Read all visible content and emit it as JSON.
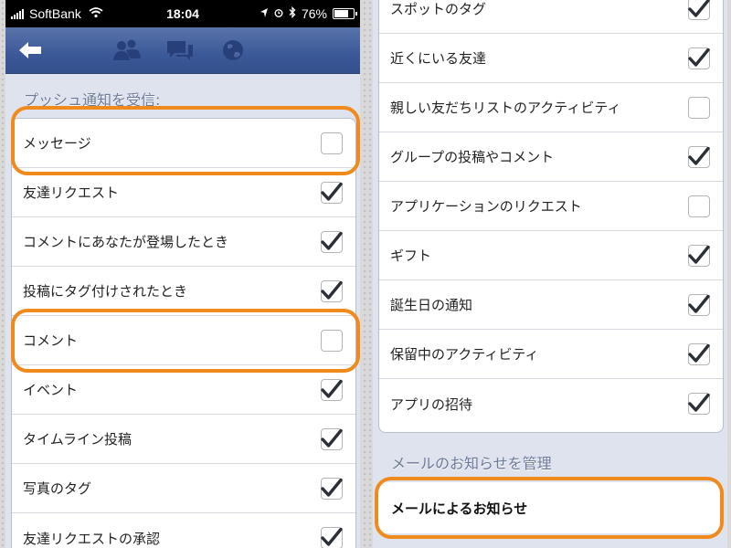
{
  "status_bar": {
    "carrier": "SoftBank",
    "time": "18:04",
    "battery": "76%",
    "battery_level": 0.76
  },
  "left_panel": {
    "section_header": "プッシュ通知を受信:",
    "items": [
      {
        "label": "メッセージ",
        "checked": false
      },
      {
        "label": "友達リクエスト",
        "checked": true
      },
      {
        "label": "コメントにあなたが登場したとき",
        "checked": true
      },
      {
        "label": "投稿にタグ付けされたとき",
        "checked": true
      },
      {
        "label": "コメント",
        "checked": false
      },
      {
        "label": "イベント",
        "checked": true
      },
      {
        "label": "タイムライン投稿",
        "checked": true
      },
      {
        "label": "写真のタグ",
        "checked": true
      },
      {
        "label": "友達リクエストの承認",
        "checked": true
      }
    ]
  },
  "right_panel": {
    "items": [
      {
        "label": "スポットのタグ",
        "checked": true
      },
      {
        "label": "近くにいる友達",
        "checked": true
      },
      {
        "label": "親しい友だちリストのアクティビティ",
        "checked": false
      },
      {
        "label": "グループの投稿やコメント",
        "checked": true
      },
      {
        "label": "アプリケーションのリクエスト",
        "checked": false
      },
      {
        "label": "ギフト",
        "checked": true
      },
      {
        "label": "誕生日の通知",
        "checked": true
      },
      {
        "label": "保留中のアクティビティ",
        "checked": true
      },
      {
        "label": "アプリの招待",
        "checked": true
      }
    ],
    "email_section_header": "メールのお知らせを管理",
    "email_item": "メールによるお知らせ"
  },
  "colors": {
    "highlight": "#f08a1c",
    "nav_bar": "#3b5998",
    "check": "#2b2f36"
  },
  "icons": {
    "back": "back-arrow-icon",
    "nav": [
      "friend-requests-icon",
      "messages-icon",
      "notifications-globe-icon"
    ]
  }
}
